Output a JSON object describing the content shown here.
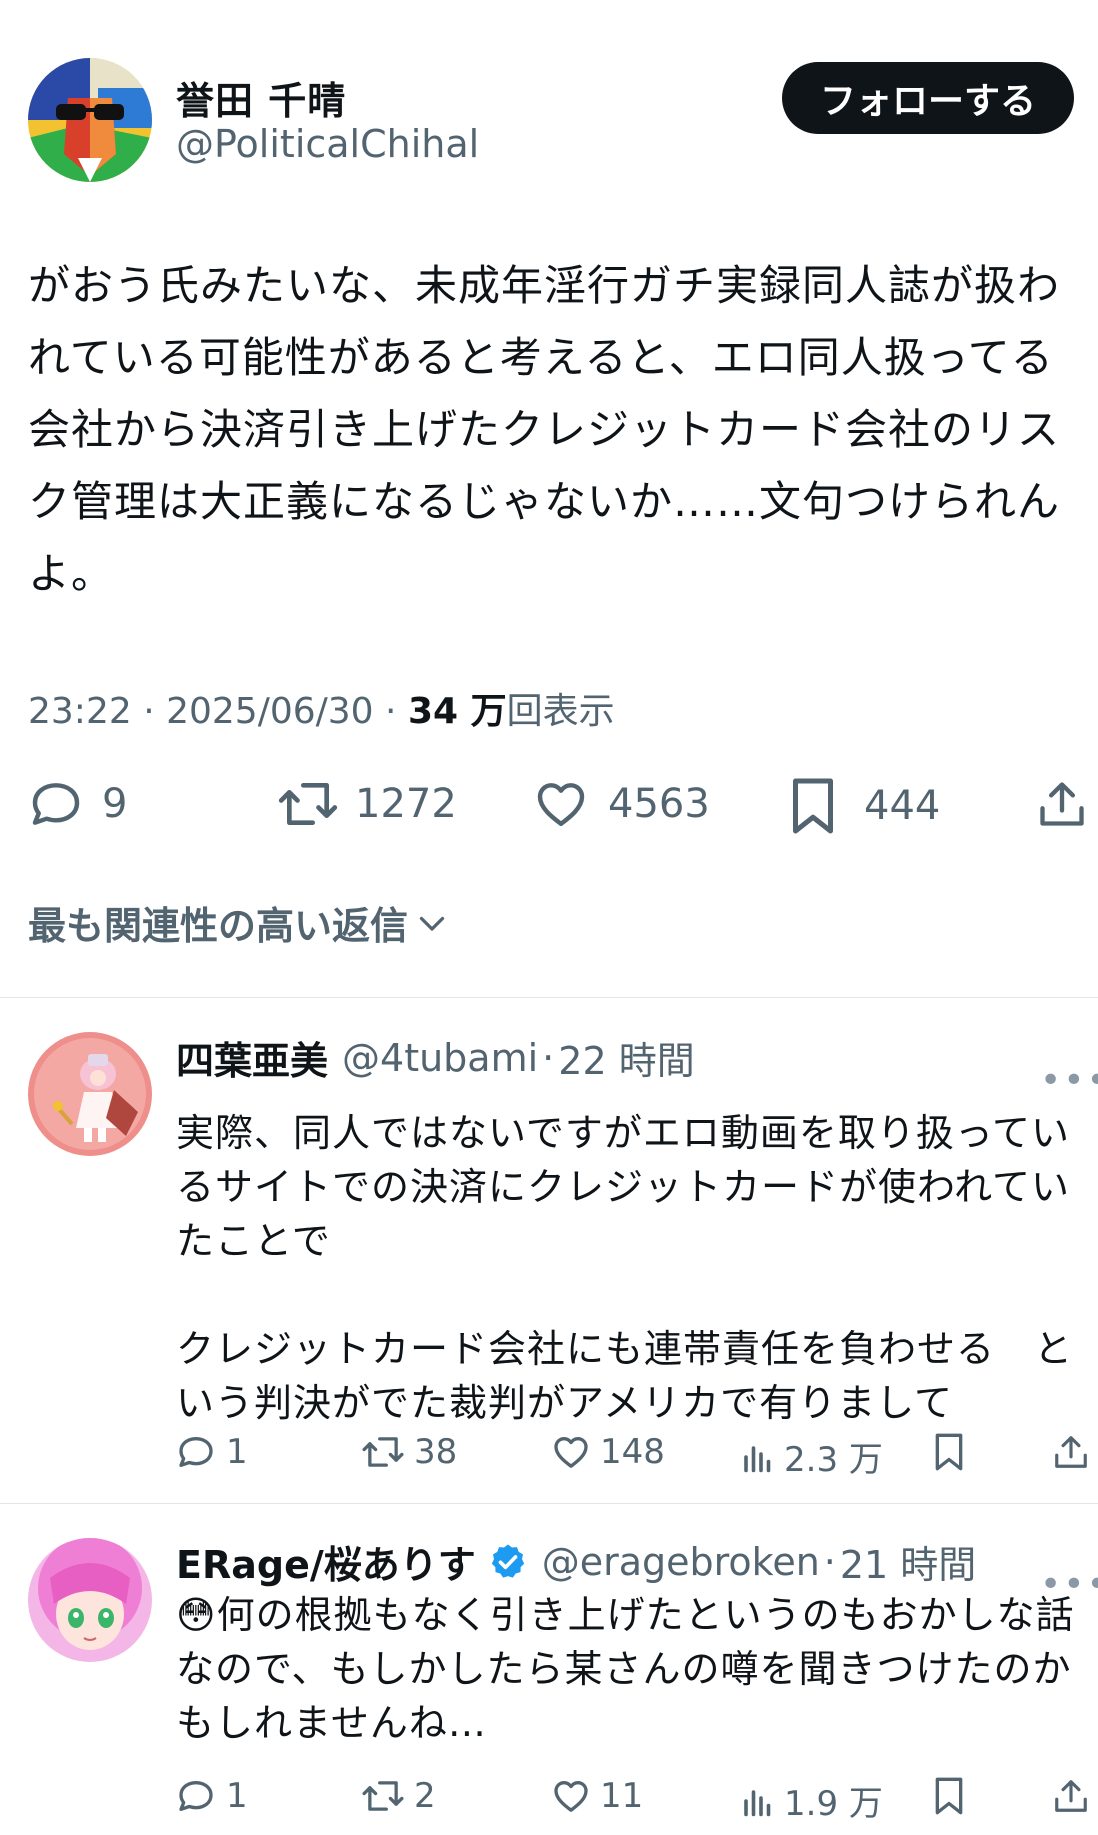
{
  "tweet": {
    "author_name": "誉田 千晴",
    "author_handle": "@PoliticalChihal",
    "follow_label": "フォローする",
    "text": "がおう氏みたいな、未成年淫行ガチ実録同人誌が扱われている可能性があると考えると、エロ同人扱ってる会社から決済引き上げたクレジットカード会社のリスク管理は大正義になるじゃないか……文句つけられんよ。",
    "time": "23:22",
    "date": "2025/06/30",
    "views_count": "34 万",
    "views_label": "回表示",
    "stats": {
      "replies": "9",
      "retweets": "1272",
      "likes": "4563",
      "bookmarks": "444"
    }
  },
  "replies_filter_label": "最も関連性の高い返信",
  "replies": [
    {
      "name": "四葉亜美",
      "handle": "@4tubami",
      "time": "22 時間",
      "text": "実際、同人ではないですがエロ動画を取り扱っているサイトでの決済にクレジットカードが使われていたことで\n\nクレジットカード会社にも連帯責任を負わせる　という判決がでた裁判がアメリカで有りまして",
      "stats": {
        "replies": "1",
        "retweets": "38",
        "likes": "148",
        "views": "2.3 万"
      }
    },
    {
      "name": "ERage/桜ありす",
      "handle": "@eragebroken",
      "time": "21 時間",
      "emoji": "😳",
      "text": "何の根拠もなく引き上げたというのもおかしな話なので、もしかしたら某さんの噂を聞きつけたのかもしれませんね…",
      "stats": {
        "replies": "1",
        "retweets": "2",
        "likes": "11",
        "views": "1.9 万"
      }
    }
  ],
  "colors": {
    "text": "#0f1419",
    "secondary": "#536471",
    "verified": "#1d9bf0",
    "divider": "#e1e6ea"
  }
}
